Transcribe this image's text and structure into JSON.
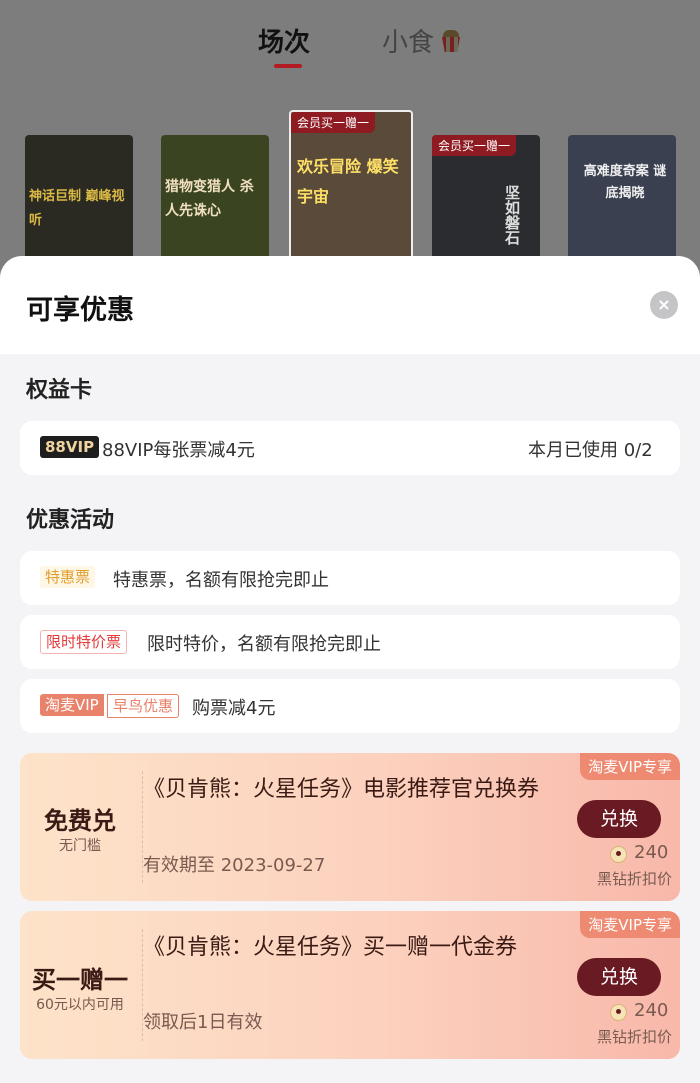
{
  "tabs": {
    "sessions": "场次",
    "snacks": "小食"
  },
  "posters": [
    {
      "badge": "",
      "text": "神话巨制 巅峰视听"
    },
    {
      "badge": "",
      "text": "猎物变猎人 杀人先诛心"
    },
    {
      "badge": "会员买一赠一",
      "text": "欢乐冒险 爆笑宇宙"
    },
    {
      "badge": "会员买一赠一",
      "text": "坚如磐石"
    },
    {
      "badge": "",
      "text": "高难度奇案 谜底揭晓"
    }
  ],
  "sheet": {
    "title": "可享优惠",
    "close_icon": "×"
  },
  "rights_section": {
    "title": "权益卡",
    "row": {
      "tag": "88VIP",
      "text": "88VIP每张票减4元",
      "usage": "本月已使用 0/2"
    }
  },
  "promo_section": {
    "title": "优惠活动",
    "rows": [
      {
        "tag": "特惠票",
        "text": "特惠票，名额有限抢完即止"
      },
      {
        "tag": "限时特价票",
        "text": "限时特价，名额有限抢完即止"
      },
      {
        "tag1": "淘麦VIP",
        "tag2": "早鸟优惠",
        "text": "购票减4元"
      }
    ]
  },
  "coupons": [
    {
      "corner": "淘麦VIP专享",
      "left_main": "免费兑",
      "left_sub": "无门槛",
      "title": "《贝肯熊：火星任务》电影推荐官兑换券",
      "validity": "有效期至 2023-09-27",
      "button": "兑换",
      "price": "240",
      "price_note": "黑钻折扣价"
    },
    {
      "corner": "淘麦VIP专享",
      "left_main": "买一赠一",
      "left_sub": "60元以内可用",
      "title": "《贝肯熊：火星任务》买一赠一代金券",
      "validity": "领取后1日有效",
      "button": "兑换",
      "price": "240",
      "price_note": "黑钻折扣价"
    }
  ],
  "colors": {
    "accent": "#b21c22",
    "button": "#6a1a22",
    "corner": "#ee8a72"
  }
}
